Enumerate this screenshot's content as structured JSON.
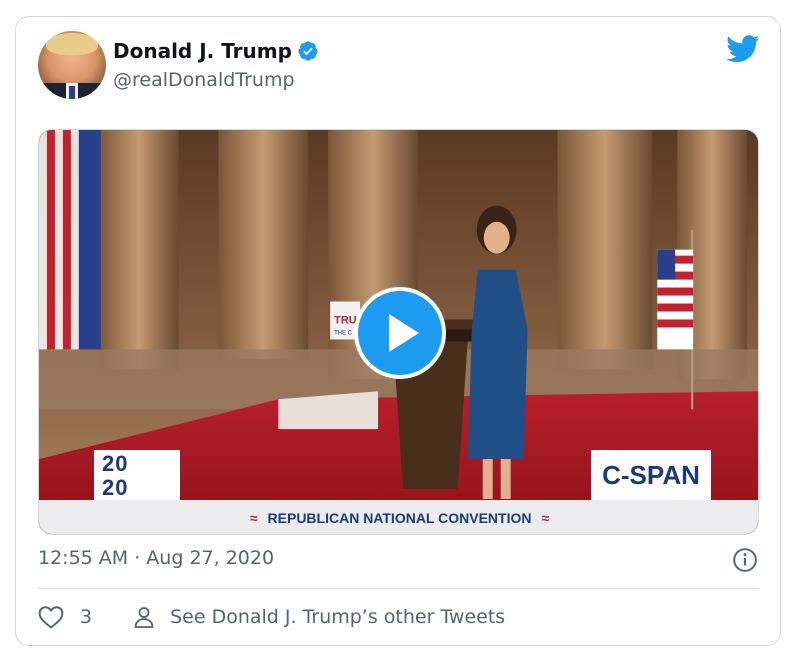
{
  "author": {
    "name": "Donald J. Trump",
    "handle": "@realDonaldTrump",
    "verified": true,
    "avatar_icon": "profile-photo"
  },
  "media": {
    "type": "video",
    "overlay_logo": {
      "line1": "20",
      "line2": "20"
    },
    "broadcaster": "C-SPAN",
    "banner": "REPUBLICAN NATIONAL CONVENTION",
    "podium_sign": "TRU",
    "podium_sign_sub": "THE C"
  },
  "tweet": {
    "timestamp": "12:55 AM · Aug 27, 2020",
    "like_count": "3",
    "other_tweets_label": "See Donald J. Trump’s other Tweets"
  },
  "colors": {
    "accent": "#1d9bf0",
    "muted_text": "#536471",
    "border": "#cfd9de"
  }
}
